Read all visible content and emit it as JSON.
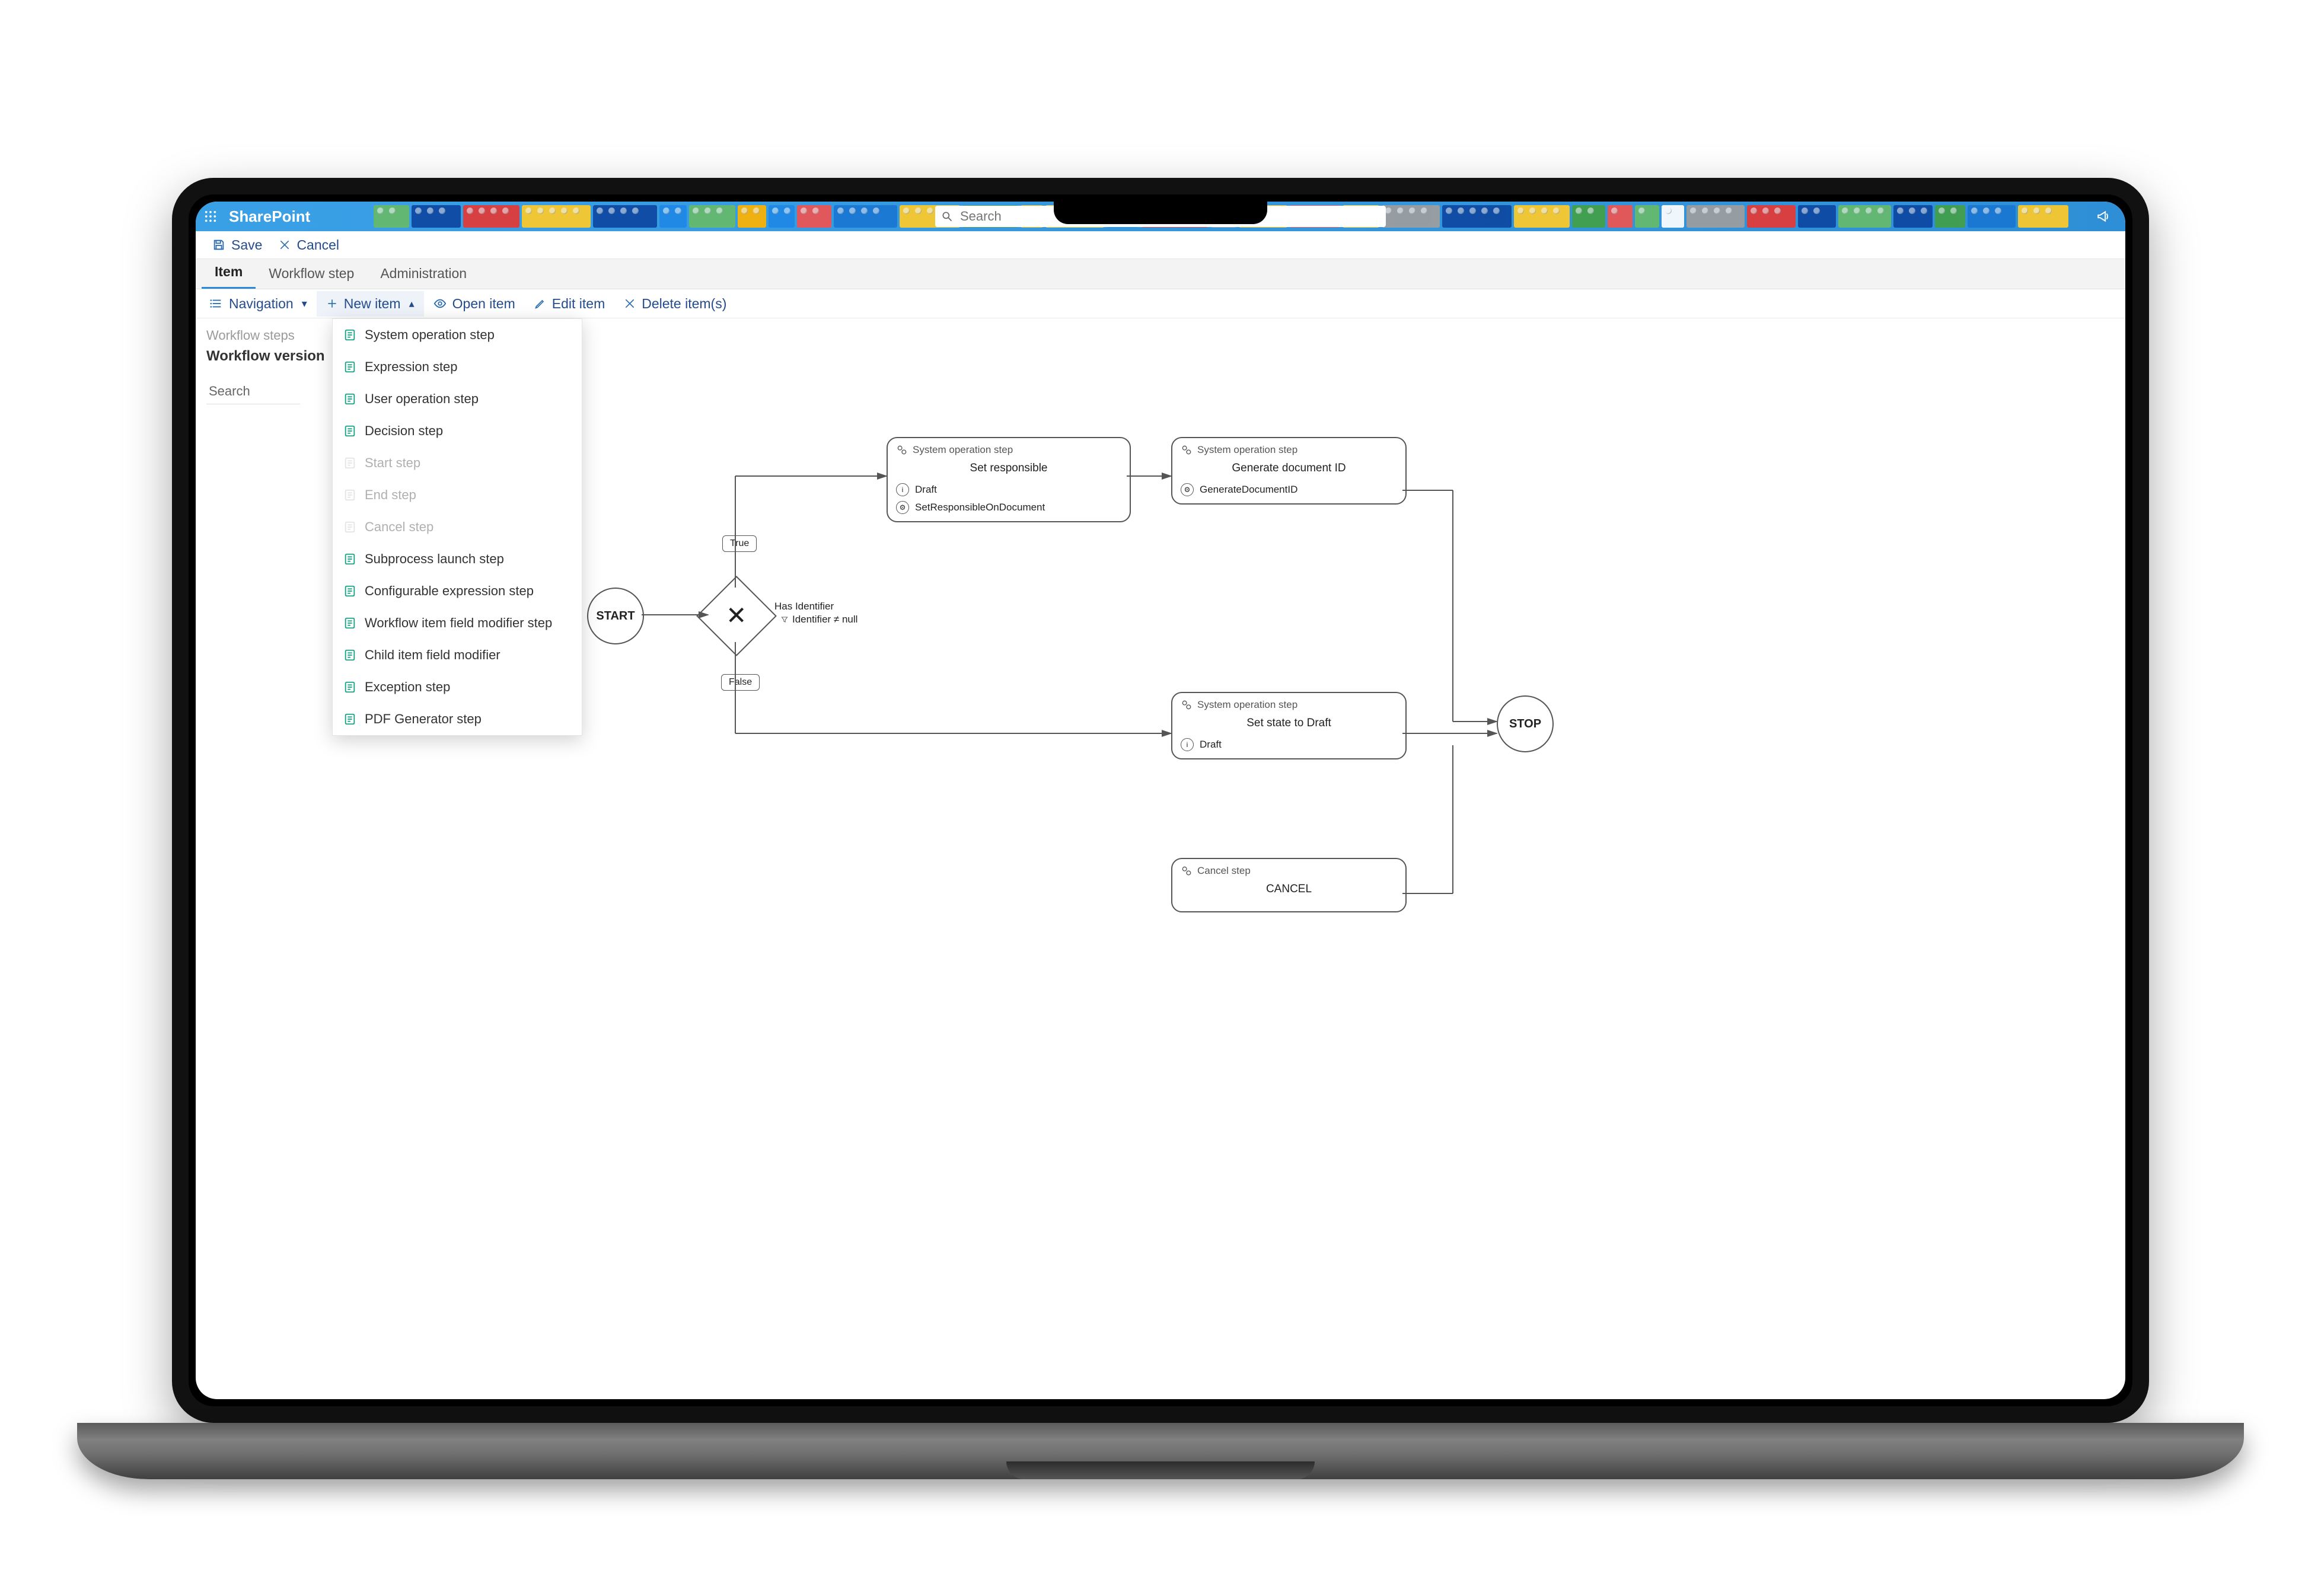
{
  "suitebar": {
    "app": "SharePoint",
    "search_placeholder": "Search"
  },
  "saveBar": {
    "save": "Save",
    "cancel": "Cancel"
  },
  "tabs": {
    "item": "Item",
    "workflow_step": "Workflow step",
    "administration": "Administration"
  },
  "cmdbar": {
    "navigation": "Navigation",
    "new_item": "New item",
    "open_item": "Open item",
    "edit_item": "Edit item",
    "delete_items": "Delete item(s)"
  },
  "left": {
    "breadcrumb": "Workflow steps",
    "title": "Workflow version",
    "search": "Search"
  },
  "newItemMenu": [
    {
      "label": "System operation step",
      "disabled": false
    },
    {
      "label": "Expression step",
      "disabled": false
    },
    {
      "label": "User operation step",
      "disabled": false
    },
    {
      "label": "Decision step",
      "disabled": false
    },
    {
      "label": "Start step",
      "disabled": true
    },
    {
      "label": "End step",
      "disabled": true
    },
    {
      "label": "Cancel step",
      "disabled": true
    },
    {
      "label": "Subprocess launch step",
      "disabled": false
    },
    {
      "label": "Configurable expression step",
      "disabled": false
    },
    {
      "label": "Workflow item field modifier step",
      "disabled": false
    },
    {
      "label": "Child item field modifier",
      "disabled": false
    },
    {
      "label": "Exception step",
      "disabled": false
    },
    {
      "label": "PDF Generator step",
      "disabled": false
    }
  ],
  "diagram": {
    "start": "START",
    "stop": "STOP",
    "decision": {
      "title": "Has Identifier",
      "sub": "Identifier ≠ null"
    },
    "branches": {
      "true": "True",
      "false": "False"
    },
    "box_setResponsible": {
      "type": "System operation step",
      "title": "Set responsible",
      "lines": [
        "Draft",
        "SetResponsibleOnDocument"
      ]
    },
    "box_generateId": {
      "type": "System operation step",
      "title": "Generate document ID",
      "lines": [
        "GenerateDocumentID"
      ]
    },
    "box_setStateDraft": {
      "type": "System operation step",
      "title": "Set state to Draft",
      "lines": [
        "Draft"
      ]
    },
    "box_cancel": {
      "type": "Cancel step",
      "title": "CANCEL"
    }
  }
}
